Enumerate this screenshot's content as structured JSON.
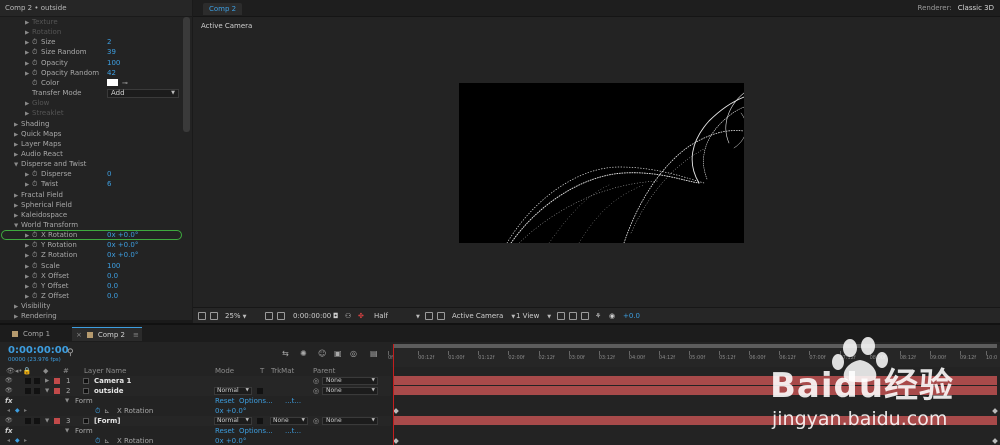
{
  "effect_controls": {
    "title": "Comp 2 • outside",
    "rows": [
      {
        "indent": 2,
        "triangle": "closed",
        "stopwatch": false,
        "label": "Texture",
        "value": "",
        "dim": true
      },
      {
        "indent": 2,
        "triangle": "closed",
        "stopwatch": false,
        "label": "Rotation",
        "value": "",
        "dim": true
      },
      {
        "indent": 2,
        "triangle": "closed",
        "stopwatch": true,
        "label": "Size",
        "value": "2"
      },
      {
        "indent": 2,
        "triangle": "closed",
        "stopwatch": true,
        "label": "Size Random",
        "value": "39"
      },
      {
        "indent": 2,
        "triangle": "closed",
        "stopwatch": true,
        "label": "Opacity",
        "value": "100"
      },
      {
        "indent": 2,
        "triangle": "closed",
        "stopwatch": true,
        "label": "Opacity Random",
        "value": "42"
      },
      {
        "indent": 2,
        "triangle": "none",
        "stopwatch": true,
        "label": "Color",
        "value": "",
        "kind": "color"
      },
      {
        "indent": 2,
        "triangle": "none",
        "stopwatch": false,
        "label": "Transfer Mode",
        "value": "Add",
        "kind": "dropdown"
      },
      {
        "indent": 2,
        "triangle": "closed",
        "stopwatch": false,
        "label": "Glow",
        "value": "",
        "dim": true
      },
      {
        "indent": 2,
        "triangle": "closed",
        "stopwatch": false,
        "label": "Streaklet",
        "value": "",
        "dim": true
      },
      {
        "indent": 1,
        "triangle": "closed",
        "stopwatch": false,
        "label": "Shading",
        "value": ""
      },
      {
        "indent": 1,
        "triangle": "closed",
        "stopwatch": false,
        "label": "Quick Maps",
        "value": ""
      },
      {
        "indent": 1,
        "triangle": "closed",
        "stopwatch": false,
        "label": "Layer Maps",
        "value": ""
      },
      {
        "indent": 1,
        "triangle": "closed",
        "stopwatch": false,
        "label": "Audio React",
        "value": ""
      },
      {
        "indent": 1,
        "triangle": "open",
        "stopwatch": false,
        "label": "Disperse and Twist",
        "value": ""
      },
      {
        "indent": 2,
        "triangle": "closed",
        "stopwatch": true,
        "label": "Disperse",
        "value": "0"
      },
      {
        "indent": 2,
        "triangle": "closed",
        "stopwatch": true,
        "label": "Twist",
        "value": "6"
      },
      {
        "indent": 1,
        "triangle": "closed",
        "stopwatch": false,
        "label": "Fractal Field",
        "value": ""
      },
      {
        "indent": 1,
        "triangle": "closed",
        "stopwatch": false,
        "label": "Spherical Field",
        "value": ""
      },
      {
        "indent": 1,
        "triangle": "closed",
        "stopwatch": false,
        "label": "Kaleidospace",
        "value": ""
      },
      {
        "indent": 1,
        "triangle": "open",
        "stopwatch": false,
        "label": "World Transform",
        "value": ""
      },
      {
        "indent": 2,
        "triangle": "closed",
        "stopwatch": true,
        "label": "X Rotation",
        "value": "0x +0.0°",
        "highlight": true
      },
      {
        "indent": 2,
        "triangle": "closed",
        "stopwatch": true,
        "label": "Y Rotation",
        "value": "0x +0.0°"
      },
      {
        "indent": 2,
        "triangle": "closed",
        "stopwatch": true,
        "label": "Z Rotation",
        "value": "0x +0.0°"
      },
      {
        "indent": 2,
        "triangle": "closed",
        "stopwatch": true,
        "label": "Scale",
        "value": "100"
      },
      {
        "indent": 2,
        "triangle": "closed",
        "stopwatch": true,
        "label": "X Offset",
        "value": "0.0"
      },
      {
        "indent": 2,
        "triangle": "closed",
        "stopwatch": true,
        "label": "Y Offset",
        "value": "0.0"
      },
      {
        "indent": 2,
        "triangle": "closed",
        "stopwatch": true,
        "label": "Z Offset",
        "value": "0.0"
      },
      {
        "indent": 1,
        "triangle": "closed",
        "stopwatch": false,
        "label": "Visibility",
        "value": ""
      },
      {
        "indent": 1,
        "triangle": "closed",
        "stopwatch": false,
        "label": "Rendering",
        "value": ""
      }
    ]
  },
  "composition": {
    "tab": "Comp 2",
    "renderer_label": "Renderer:",
    "renderer_value": "Classic 3D",
    "view_name": "Active Camera",
    "footer": {
      "zoom": "25%",
      "timecode": "0:00:00:00",
      "resolution": "Half",
      "camera": "Active Camera",
      "views": "1 View",
      "exposure": "+0.0"
    }
  },
  "timeline": {
    "tabs": [
      {
        "label": "Comp 1",
        "active": false
      },
      {
        "label": "Comp 2",
        "active": true
      }
    ],
    "timecode": "0:00:00:00",
    "fps": "00000 (23.976 fps)",
    "columns": {
      "num": "#",
      "layer_name": "Layer Name",
      "mode": "Mode",
      "t": "T",
      "trkmat": "TrkMat",
      "parent": "Parent"
    },
    "ruler": [
      "0f",
      "00:12f",
      "01:00f",
      "01:12f",
      "02:00f",
      "02:12f",
      "03:00f",
      "03:12f",
      "04:00f",
      "04:12f",
      "05:00f",
      "05:12f",
      "06:00f",
      "06:12f",
      "07:00f",
      "07:12f",
      "08:00f",
      "08:12f",
      "09:00f",
      "09:12f",
      "10:0"
    ],
    "layers": [
      {
        "kind": "layer",
        "num": "1",
        "name": "Camera 1",
        "color": "#c24a4a",
        "mode": "",
        "trkmat": "",
        "parent": "None",
        "expanded": false
      },
      {
        "kind": "layer",
        "num": "2",
        "name": "outside",
        "color": "#c24a4a",
        "mode": "Normal",
        "trkmat": "",
        "parent": "None",
        "expanded": true
      },
      {
        "kind": "group",
        "name": "Form",
        "reset": "Reset",
        "options": "Options...",
        "more": "...t..."
      },
      {
        "kind": "prop",
        "name": "X Rotation",
        "value": "0x +0.0°"
      },
      {
        "kind": "layer",
        "num": "3",
        "name": "[Form]",
        "color": "#c24a4a",
        "mode": "Normal",
        "trkmat": "None",
        "parent": "None",
        "expanded": true
      },
      {
        "kind": "group",
        "name": "Form",
        "reset": "Reset",
        "options": "Options...",
        "more": "...t..."
      },
      {
        "kind": "prop",
        "name": "X Rotation",
        "value": "0x +0.0°"
      }
    ]
  },
  "watermark": {
    "brand": "Baidu经验",
    "url": "jingyan.baidu.com"
  }
}
